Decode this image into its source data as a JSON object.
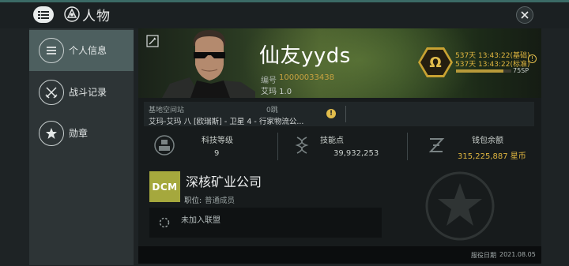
{
  "window": {
    "title": "人物",
    "close_icon": "close-icon",
    "menu_icon": "menu-icon",
    "title_icon": "character-icon"
  },
  "sidebar": {
    "items": [
      {
        "label": "个人信息",
        "icon": "list-icon",
        "active": true
      },
      {
        "label": "战斗记录",
        "icon": "crossed-swords-icon",
        "active": false
      },
      {
        "label": "勋章",
        "icon": "star-icon",
        "active": false
      }
    ]
  },
  "character": {
    "name": "仙友yyds",
    "id_label": "编号",
    "id": "10000033438",
    "security": "艾玛 1.0"
  },
  "omega": {
    "symbol": "Ω",
    "line1": "537天 13:43:22(基础)",
    "line2": "537天 13:43:22(标准)",
    "sp": "75SP",
    "sp_level": 0.85,
    "accent": "#c8a232"
  },
  "location": {
    "label": "基地空间站",
    "jumps": "0跳",
    "value": "艾玛-艾玛 八 [欧瑞斯] - 卫星 4 - 行家物流公..."
  },
  "stats": [
    {
      "label": "科技等级",
      "value": "9",
      "icon": "tech-level-icon"
    },
    {
      "label": "技能点",
      "value": "39,932,253",
      "icon": "dna-skill-icon"
    },
    {
      "label": "钱包余额",
      "value": "315,225,887 星币",
      "icon": "isk-icon"
    }
  ],
  "corp": {
    "logo_text": "DCM",
    "name": "深核矿业公司",
    "position_label": "职位:",
    "position": "普通成员",
    "alliance": "未加入联盟"
  },
  "footer": {
    "label": "服役日期",
    "date": "2021.08.05"
  }
}
